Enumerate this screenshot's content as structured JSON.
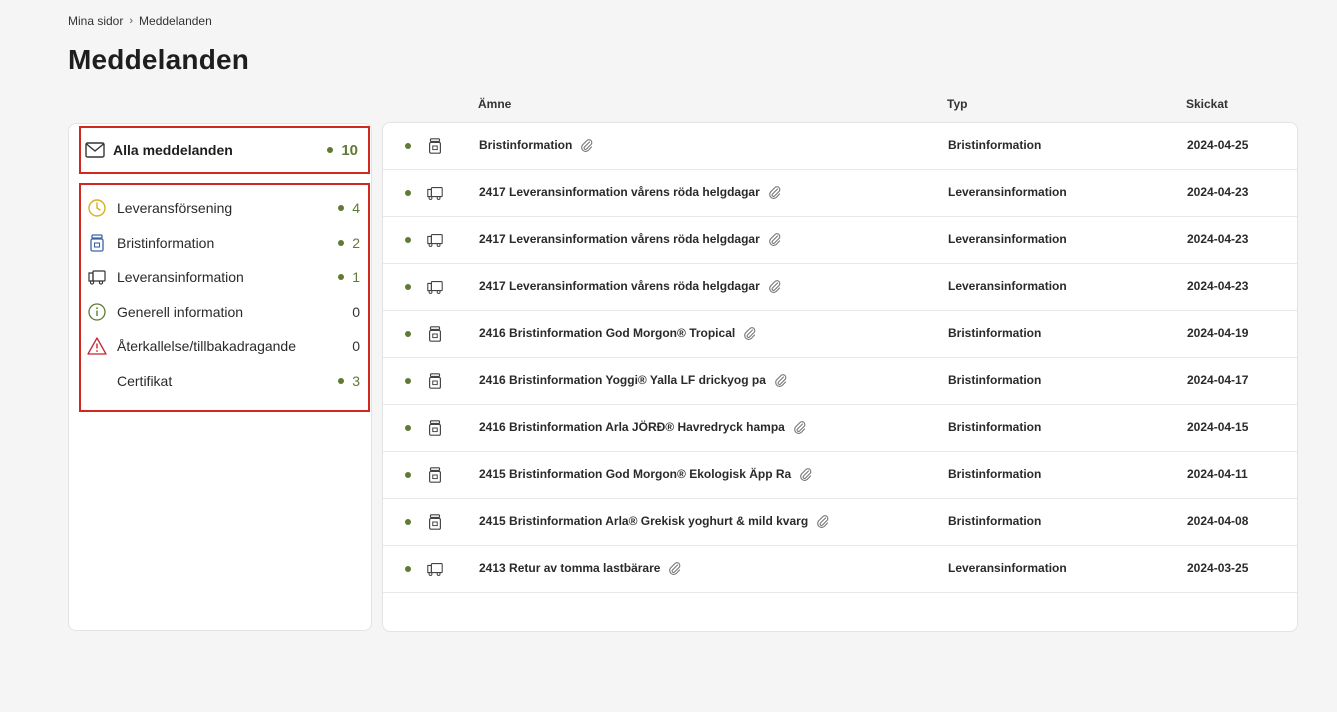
{
  "breadcrumb": {
    "root": "Mina sidor",
    "separator": "›",
    "current": "Meddelanden"
  },
  "page": {
    "title": "Meddelanden"
  },
  "sidebar": {
    "all": {
      "label": "Alla meddelanden",
      "count": "10",
      "icon": "envelope-icon"
    },
    "categories": [
      {
        "label": "Leveransförsening",
        "count": "4",
        "has_dot": true,
        "icon": "clock-icon",
        "color": "#d8b020"
      },
      {
        "label": "Bristinformation",
        "count": "2",
        "has_dot": true,
        "icon": "jar-icon",
        "color": "#3b64a8"
      },
      {
        "label": "Leveransinformation",
        "count": "1",
        "has_dot": true,
        "icon": "truck-icon",
        "color": "#333333"
      },
      {
        "label": "Generell information",
        "count": "0",
        "has_dot": false,
        "icon": "info-icon",
        "color": "#5f7a34"
      },
      {
        "label": "Återkallelse/tillbakadragande",
        "count": "0",
        "has_dot": false,
        "icon": "warning-icon",
        "color": "#c0282e"
      },
      {
        "label": "Certifikat",
        "count": "3",
        "has_dot": true,
        "icon": "",
        "color": ""
      }
    ]
  },
  "table": {
    "headers": {
      "subject": "Ämne",
      "type": "Typ",
      "sent": "Skickat"
    },
    "rows": [
      {
        "subject": "Bristinformation",
        "type": "Bristinformation",
        "date": "2024-04-25",
        "icon": "jar-icon"
      },
      {
        "subject": "2417 Leveransinformation vårens röda helgdagar",
        "type": "Leveransinformation",
        "date": "2024-04-23",
        "icon": "truck-icon"
      },
      {
        "subject": "2417 Leveransinformation vårens röda helgdagar",
        "type": "Leveransinformation",
        "date": "2024-04-23",
        "icon": "truck-icon"
      },
      {
        "subject": "2417 Leveransinformation vårens röda helgdagar",
        "type": "Leveransinformation",
        "date": "2024-04-23",
        "icon": "truck-icon"
      },
      {
        "subject": "2416 Bristinformation God Morgon® Tropical",
        "type": "Bristinformation",
        "date": "2024-04-19",
        "icon": "jar-icon"
      },
      {
        "subject": "2416 Bristinformation Yoggi® Yalla LF drickyog pa",
        "type": "Bristinformation",
        "date": "2024-04-17",
        "icon": "jar-icon"
      },
      {
        "subject": "2416 Bristinformation Arla JÖRÐ® Havredryck hampa",
        "type": "Bristinformation",
        "date": "2024-04-15",
        "icon": "jar-icon"
      },
      {
        "subject": "2415 Bristinformation God Morgon® Ekologisk Äpp Ra",
        "type": "Bristinformation",
        "date": "2024-04-11",
        "icon": "jar-icon"
      },
      {
        "subject": "2415 Bristinformation Arla® Grekisk yoghurt & mild kvarg",
        "type": "Bristinformation",
        "date": "2024-04-08",
        "icon": "jar-icon"
      },
      {
        "subject": "2413 Retur av tomma lastbärare",
        "type": "Leveransinformation",
        "date": "2024-03-25",
        "icon": "truck-icon"
      }
    ]
  }
}
